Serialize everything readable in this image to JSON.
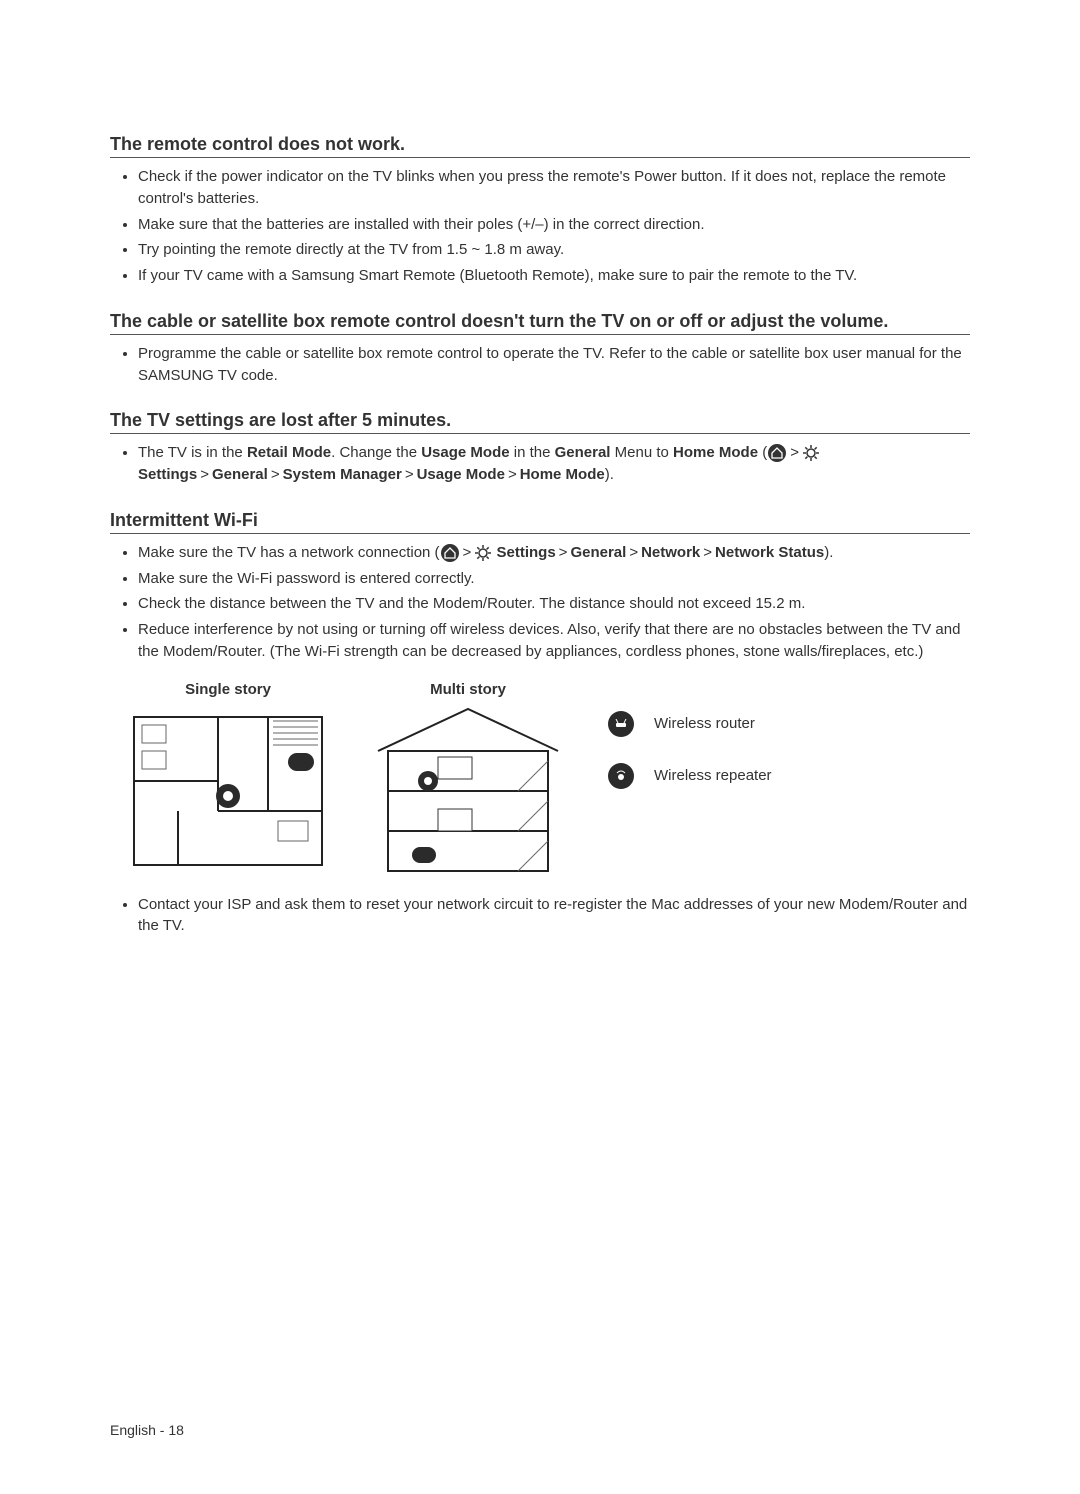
{
  "sections": {
    "remote": {
      "title": "The remote control does not work.",
      "items": [
        "Check if the power indicator on the TV blinks when you press the remote's Power button. If it does not, replace the remote control's batteries.",
        "Make sure that the batteries are installed with their poles (+/–) in the correct direction.",
        "Try pointing the remote directly at the TV from 1.5 ~ 1.8 m away.",
        "If your TV came with a Samsung Smart Remote (Bluetooth Remote), make sure to pair the remote to the TV."
      ]
    },
    "cable": {
      "title": "The cable or satellite box remote control doesn't turn the TV on or off or adjust the volume.",
      "items": [
        "Programme the cable or satellite box remote control to operate the TV. Refer to the cable or satellite box user manual for the SAMSUNG TV code."
      ]
    },
    "settings_lost": {
      "title": "The TV settings are lost after 5 minutes.",
      "item": {
        "pre": "The TV is in the ",
        "retail_mode": "Retail Mode",
        "mid1": ". Change the ",
        "usage_mode": "Usage Mode",
        "mid2": " in the ",
        "general": "General",
        "mid3": " Menu to ",
        "home_mode": "Home Mode",
        "open": " (",
        "gt": ">",
        "settings_lbl": "Settings",
        "general2": "General",
        "system_manager": "System Manager",
        "usage_mode2": "Usage Mode",
        "home_mode2": "Home Mode",
        "close": ")."
      }
    },
    "wifi": {
      "title": "Intermittent Wi-Fi",
      "item1": {
        "pre": "Make sure the TV has a network connection (",
        "gt": ">",
        "settings_lbl": "Settings",
        "general": "General",
        "network": "Network",
        "network_status": "Network Status",
        "close": ")."
      },
      "items_rest": [
        "Make sure the Wi-Fi password is entered correctly.",
        "Check the distance between the TV and the Modem/Router. The distance should not exceed 15.2 m.",
        "Reduce interference by not using or turning off wireless devices. Also, verify that there are no obstacles between the TV and the Modem/Router. (The Wi-Fi strength can be decreased by appliances, cordless phones, stone walls/fireplaces, etc.)"
      ],
      "diagrams": {
        "single": "Single story",
        "multi": "Multi story",
        "legend_router": "Wireless router",
        "legend_repeater": "Wireless repeater"
      },
      "item_last": "Contact your ISP and ask them to reset your network circuit to re-register the Mac addresses of your new Modem/Router and the TV."
    }
  },
  "footer": "English - 18"
}
